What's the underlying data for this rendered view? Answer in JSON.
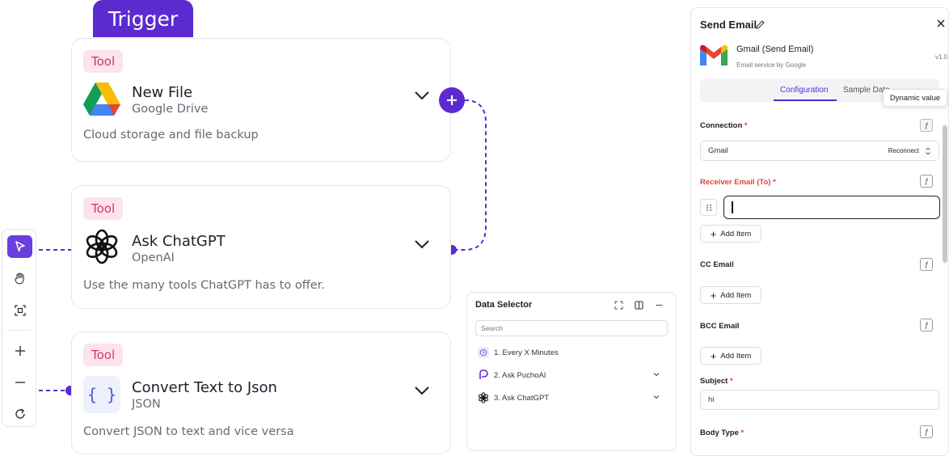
{
  "trigger_tab": {
    "label": "Trigger"
  },
  "nodes": [
    {
      "badge": "Tool",
      "title": "New File",
      "subtitle": "Google Drive",
      "description": "Cloud storage and file backup",
      "icon": "google-drive-icon"
    },
    {
      "badge": "Tool",
      "title": "Ask ChatGPT",
      "subtitle": "OpenAI",
      "description": "Use the many tools ChatGPT has to offer.",
      "icon": "openai-icon"
    },
    {
      "badge": "Tool",
      "title": "Convert Text to Json",
      "subtitle": "JSON",
      "description": "Convert JSON to text and vice versa",
      "icon": "json-braces-icon"
    }
  ],
  "toolbar": {
    "items": [
      "pointer-icon",
      "hand-icon",
      "fit-view-icon",
      "zoom-in-icon",
      "zoom-out-icon",
      "reset-icon"
    ]
  },
  "data_selector": {
    "title": "Data Selector",
    "search_placeholder": "Search",
    "items": [
      {
        "label": "1. Every X Minutes",
        "icon": "clock-icon",
        "expandable": false
      },
      {
        "label": "2. Ask PuchoAI",
        "icon": "pucho-icon",
        "expandable": true
      },
      {
        "label": "3. Ask ChatGPT",
        "icon": "openai-icon",
        "expandable": true
      }
    ]
  },
  "right_panel": {
    "title": "Send Email",
    "app_name": "Gmail (Send Email)",
    "app_subtitle": "Email service by Google",
    "version": "v1.0",
    "tabs": [
      {
        "label": "Configuration",
        "active": true
      },
      {
        "label": "Sample Data",
        "active": false
      }
    ],
    "tooltip": "Dynamic value",
    "connection": {
      "label": "Connection",
      "value": "Gmail",
      "action": "Reconnect"
    },
    "receiver": {
      "label": "Receiver Email (To)",
      "value": ""
    },
    "cc": {
      "label": "CC Email"
    },
    "bcc": {
      "label": "BCC Email"
    },
    "add_item_label": "Add Item",
    "subject": {
      "label": "Subject",
      "value": "hi"
    },
    "body_type": {
      "label": "Body Type"
    },
    "required_marker": "*"
  },
  "colors": {
    "accent": "#5b2bd0",
    "badge_bg": "#fde4ec",
    "badge_text": "#d6336c",
    "required": "#d9463b"
  }
}
